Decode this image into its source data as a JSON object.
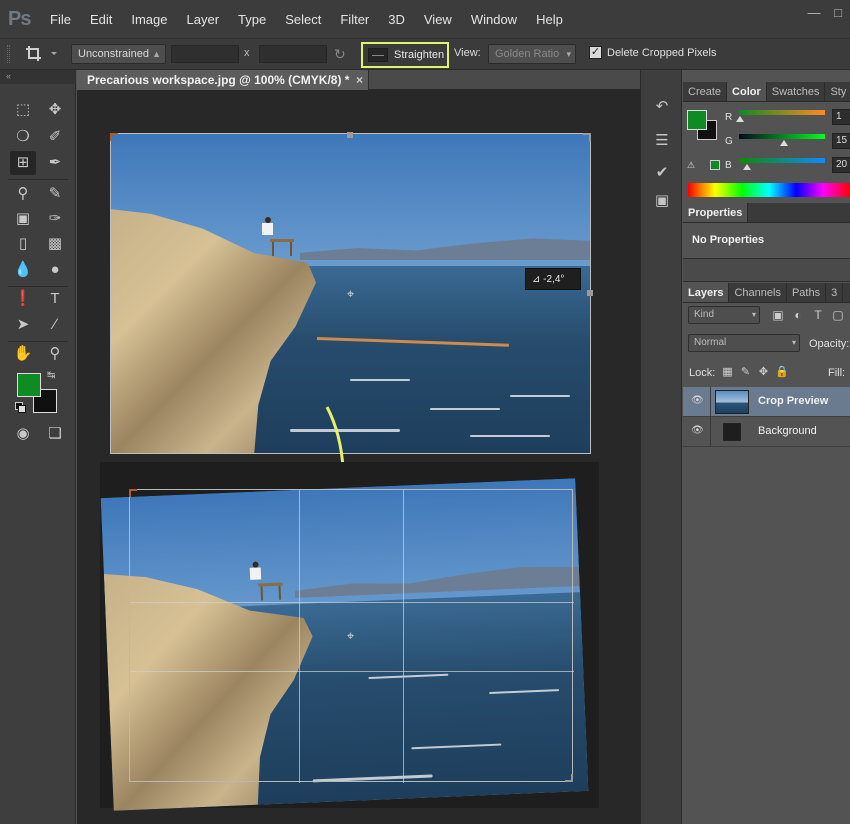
{
  "app": {
    "logo": "Ps",
    "menu": [
      "File",
      "Edit",
      "Image",
      "Layer",
      "Type",
      "Select",
      "Filter",
      "3D",
      "View",
      "Window",
      "Help"
    ],
    "window_controls": [
      "—",
      "□"
    ]
  },
  "options_bar": {
    "ratio_select": "Unconstrained",
    "x_separator": "x",
    "straighten_label": "Straighten",
    "view_label": "View:",
    "view_select": "Golden Ratio",
    "delete_cropped_label": "Delete Cropped Pixels",
    "delete_cropped_checked": true
  },
  "document": {
    "tab_title": "Precarious workspace.jpg @ 100% (CMYK/8) *",
    "close_glyph": "×",
    "angle_readout": "-2,4°",
    "angle_glyph": "⊿"
  },
  "colors": {
    "foreground": "#0f8a24",
    "background": "#101010",
    "highlight": "#e0f36a"
  },
  "panels": {
    "color_tabs": [
      "Create",
      "Color",
      "Swatches",
      "Sty"
    ],
    "color_active": "Color",
    "channels": [
      {
        "label": "R",
        "value": "1"
      },
      {
        "label": "G",
        "value": "15"
      },
      {
        "label": "B",
        "value": "20"
      }
    ],
    "properties_tab": "Properties",
    "properties_body": "No Properties",
    "layers_tabs": [
      "Layers",
      "Channels",
      "Paths",
      "3"
    ],
    "layers_active": "Layers",
    "filter_kind": "Kind",
    "blend_mode": "Normal",
    "opacity_label": "Opacity:",
    "lock_label": "Lock:",
    "fill_label": "Fill:",
    "layers": [
      {
        "name": "Crop Preview",
        "selected": true
      },
      {
        "name": "Background",
        "selected": false
      }
    ]
  }
}
